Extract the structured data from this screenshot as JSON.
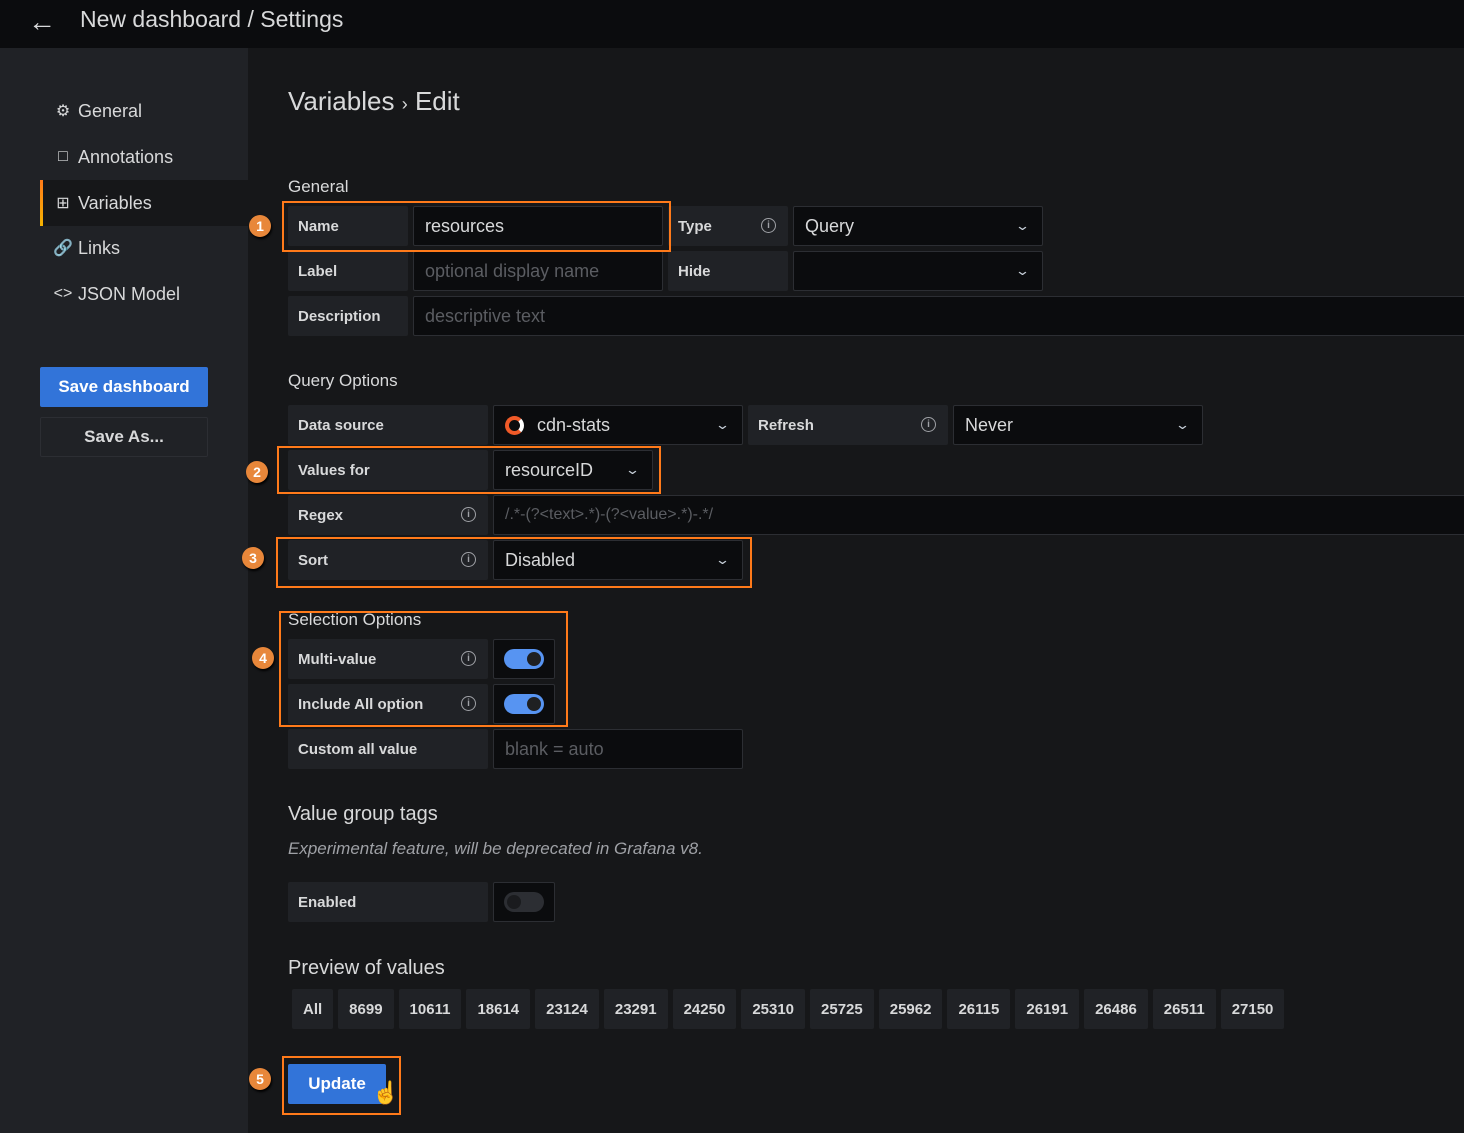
{
  "header": {
    "back_icon": "arrow-left-icon",
    "title": "New dashboard / Settings"
  },
  "sidebar": {
    "items": [
      {
        "label": "General",
        "icon": "sliders-icon"
      },
      {
        "label": "Annotations",
        "icon": "comment-icon"
      },
      {
        "label": "Variables",
        "icon": "calculator-icon",
        "active": true
      },
      {
        "label": "Links",
        "icon": "link-icon"
      },
      {
        "label": "JSON Model",
        "icon": "code-icon"
      }
    ],
    "save_dashboard": "Save dashboard",
    "save_as": "Save As..."
  },
  "colors": {
    "accent": "#3274d9",
    "highlight": "#ff7a1a",
    "toggle_on": "#5794f2"
  },
  "main": {
    "title": "Variables",
    "title_sep": "›",
    "title_sub": "Edit",
    "general": {
      "heading": "General",
      "name_label": "Name",
      "name_value": "resources",
      "type_label": "Type",
      "type_value": "Query",
      "label_label": "Label",
      "label_placeholder": "optional display name",
      "hide_label": "Hide",
      "hide_value": "",
      "description_label": "Description",
      "description_placeholder": "descriptive text"
    },
    "query": {
      "heading": "Query Options",
      "datasource_label": "Data source",
      "datasource_value": "cdn-stats",
      "refresh_label": "Refresh",
      "refresh_value": "Never",
      "values_for_label": "Values for",
      "values_for_value": "resourceID",
      "regex_label": "Regex",
      "regex_placeholder": "/.*-(?<text>.*)-(?<value>.*)-.*/",
      "sort_label": "Sort",
      "sort_value": "Disabled"
    },
    "selection": {
      "heading": "Selection Options",
      "multi_label": "Multi-value",
      "multi_on": true,
      "include_all_label": "Include All option",
      "include_all_on": true,
      "custom_all_label": "Custom all value",
      "custom_all_placeholder": "blank = auto"
    },
    "tags": {
      "heading": "Value group tags",
      "note": "Experimental feature, will be deprecated in Grafana v8.",
      "enabled_label": "Enabled",
      "enabled_on": false
    },
    "preview": {
      "heading": "Preview of values",
      "values": [
        "All",
        "8699",
        "10611",
        "18614",
        "23124",
        "23291",
        "24250",
        "25310",
        "25725",
        "25962",
        "26115",
        "26191",
        "26486",
        "26511",
        "27150"
      ]
    },
    "update": "Update"
  },
  "annotations": [
    "1",
    "2",
    "3",
    "4",
    "5"
  ]
}
